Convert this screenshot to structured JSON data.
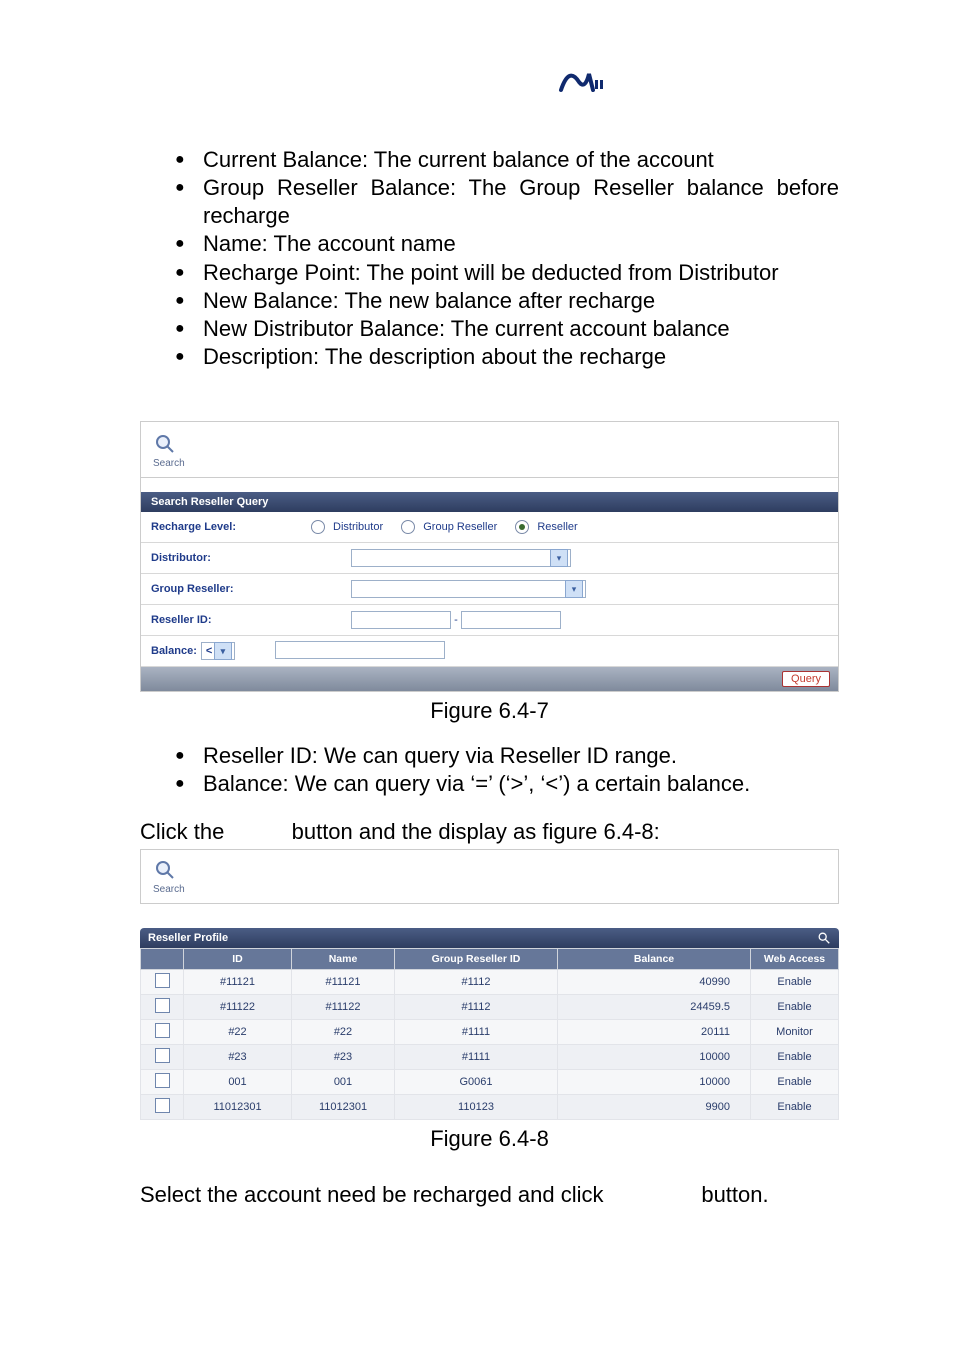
{
  "bullets_top": [
    "Current Balance: The current balance of the account",
    "Group Reseller Balance: The Group Reseller balance before recharge",
    "Name: The account name",
    "Recharge Point: The point will be deducted from Distributor",
    "New Balance: The new balance after recharge",
    "New Distributor Balance: The current account balance",
    "Description: The description about the recharge"
  ],
  "panel647": {
    "search_icon_label": "Search",
    "header": "Search Reseller Query",
    "rows": {
      "recharge_level_label": "Recharge Level:",
      "radio_distributor": "Distributor",
      "radio_group_reseller": "Group Reseller",
      "radio_reseller": "Reseller",
      "distributor_label": "Distributor:",
      "group_reseller_label": "Group Reseller:",
      "reseller_id_label": "Reseller ID:",
      "balance_label": "Balance:",
      "balance_op": "<"
    },
    "query_btn": "Query"
  },
  "fig647_caption": "Figure 6.4-7",
  "bullets_mid": [
    "Reseller ID: We can query via Reseller ID range.",
    "Balance: We can query via ‘=’ (‘>’, ‘<’) a certain balance."
  ],
  "click_line_pre": "Click the",
  "click_line_post": "button and the display as figure 6.4-8:",
  "panel648_search_label": "Search",
  "profile": {
    "title": "Reseller Profile",
    "columns": [
      "",
      "ID",
      "Name",
      "Group Reseller ID",
      "Balance",
      "Web Access"
    ],
    "rows": [
      {
        "id": "#11121",
        "name": "#11121",
        "grid": "#1112",
        "balance": "40990",
        "web": "Enable"
      },
      {
        "id": "#11122",
        "name": "#11122",
        "grid": "#1112",
        "balance": "24459.5",
        "web": "Enable"
      },
      {
        "id": "#22",
        "name": "#22",
        "grid": "#1111",
        "balance": "20111",
        "web": "Monitor"
      },
      {
        "id": "#23",
        "name": "#23",
        "grid": "#1111",
        "balance": "10000",
        "web": "Enable"
      },
      {
        "id": "001",
        "name": "001",
        "grid": "G0061",
        "balance": "10000",
        "web": "Enable"
      },
      {
        "id": "11012301",
        "name": "11012301",
        "grid": "110123",
        "balance": "9900",
        "web": "Enable"
      }
    ]
  },
  "fig648_caption": "Figure 6.4-8",
  "final_line_pre": "Select the account need be recharged and click",
  "final_line_post": "button."
}
